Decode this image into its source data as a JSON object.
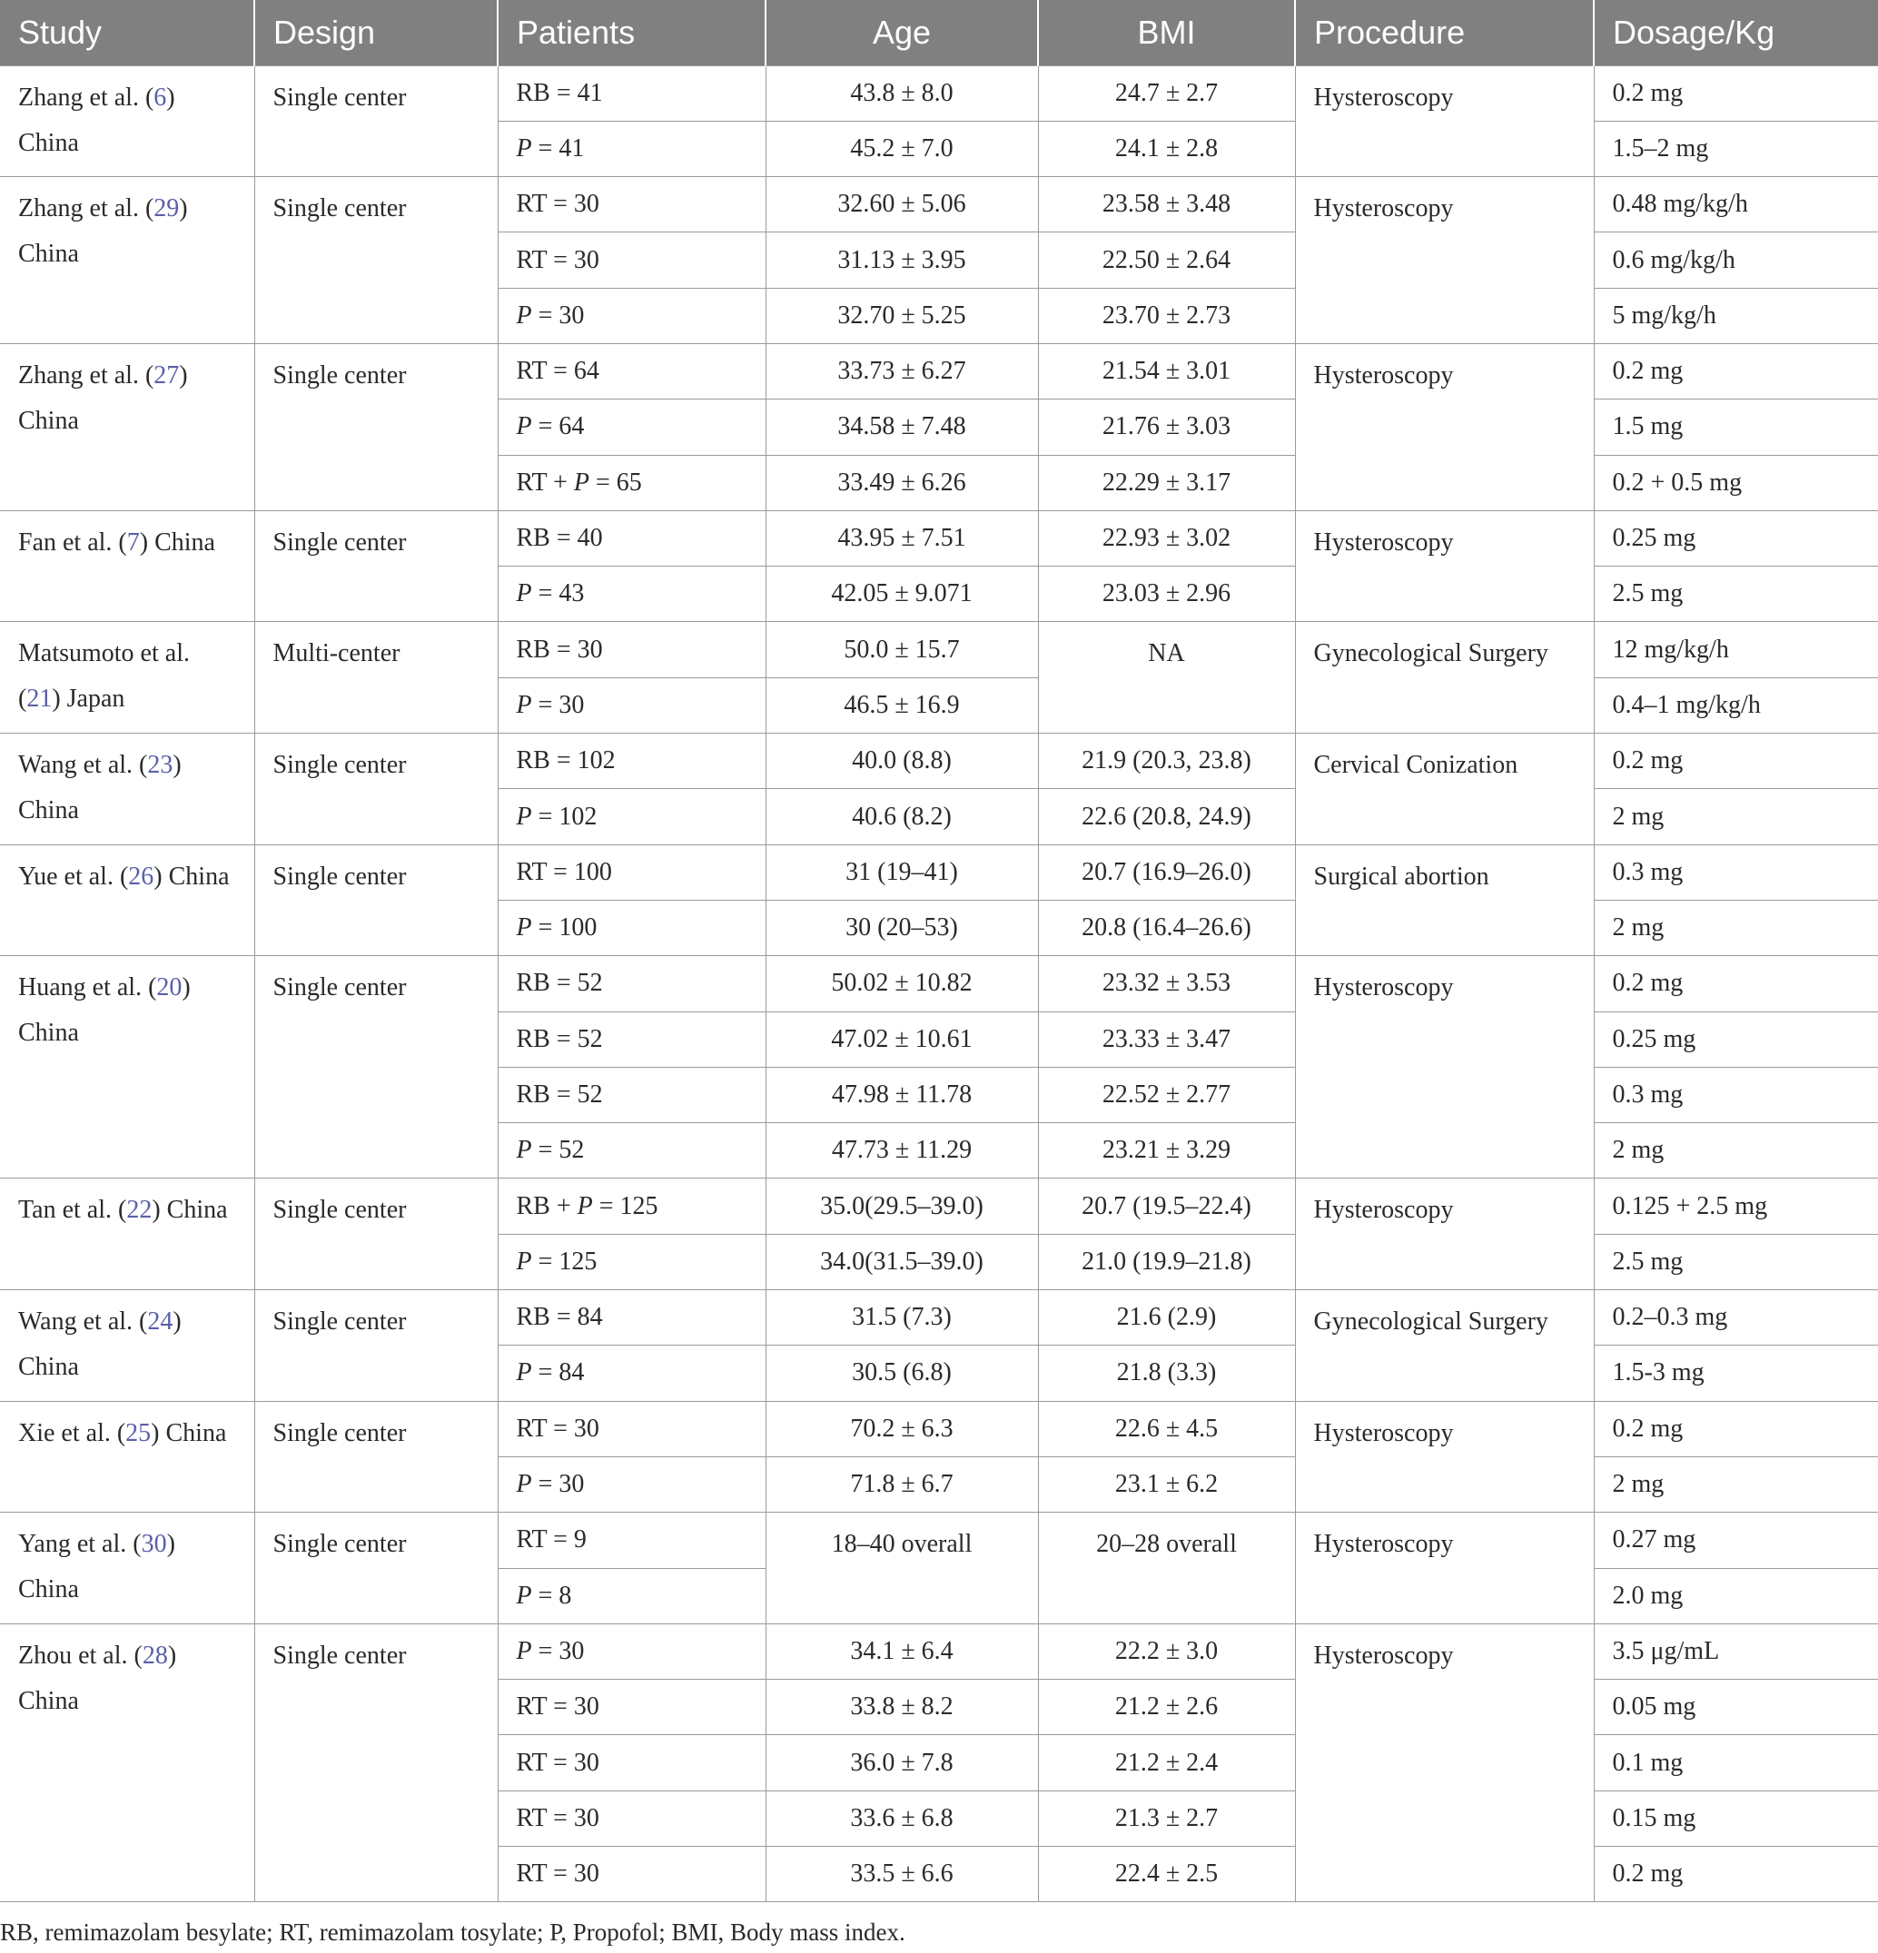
{
  "headers": [
    "Study",
    "Design",
    "Patients",
    "Age",
    "BMI",
    "Procedure",
    "Dosage/Kg"
  ],
  "studies": [
    {
      "author": "Zhang et al. (",
      "ref": "6",
      "after": ")",
      "country": "China",
      "design": "Single center",
      "procedure": "Hysteroscopy",
      "arms": [
        {
          "group": "RB = 41",
          "age": "43.8 ± 8.0",
          "bmi": "24.7 ± 2.7",
          "dosage": "0.2 mg"
        },
        {
          "group": "P = 41",
          "age": "45.2 ± 7.0",
          "bmi": "24.1 ± 2.8",
          "dosage": "1.5–2 mg"
        }
      ]
    },
    {
      "author": "Zhang et al. (",
      "ref": "29",
      "after": ")",
      "country": "China",
      "design": "Single center",
      "procedure": "Hysteroscopy",
      "arms": [
        {
          "group": "RT = 30",
          "age": "32.60 ± 5.06",
          "bmi": "23.58 ± 3.48",
          "dosage": "0.48 mg/kg/h"
        },
        {
          "group": "RT = 30",
          "age": "31.13 ± 3.95",
          "bmi": "22.50 ± 2.64",
          "dosage": "0.6 mg/kg/h"
        },
        {
          "group": "P = 30",
          "age": "32.70 ± 5.25",
          "bmi": "23.70 ± 2.73",
          "dosage": "5 mg/kg/h"
        }
      ]
    },
    {
      "author": "Zhang et al. (",
      "ref": "27",
      "after": ")",
      "country": "China",
      "design": "Single center",
      "procedure": "Hysteroscopy",
      "arms": [
        {
          "group": "RT = 64",
          "age": "33.73 ± 6.27",
          "bmi": "21.54 ± 3.01",
          "dosage": "0.2 mg"
        },
        {
          "group": "P = 64",
          "age": "34.58 ± 7.48",
          "bmi": "21.76 ± 3.03",
          "dosage": "1.5 mg"
        },
        {
          "group": "RT + P = 65",
          "age": "33.49 ± 6.26",
          "bmi": "22.29 ± 3.17",
          "dosage": "0.2 + 0.5 mg"
        }
      ]
    },
    {
      "author": "Fan et al. (",
      "ref": "7",
      "after": ") China",
      "country": "",
      "design": "Single center",
      "procedure": "Hysteroscopy",
      "arms": [
        {
          "group": "RB = 40",
          "age": "43.95 ± 7.51",
          "bmi": "22.93 ± 3.02",
          "dosage": "0.25 mg"
        },
        {
          "group": "P = 43",
          "age": "42.05 ± 9.071",
          "bmi": "23.03 ± 2.96",
          "dosage": "2.5 mg"
        }
      ]
    },
    {
      "author": "Matsumoto et al.",
      "ref": "21",
      "after": ") Japan",
      "country": "",
      "design": "Multi-center",
      "procedure": "Gynecological Surgery",
      "bmi_merged": "NA",
      "arms": [
        {
          "group": "RB = 30",
          "age": "50.0 ± 15.7",
          "bmi": "",
          "dosage": "12 mg/kg/h"
        },
        {
          "group": "P = 30",
          "age": "46.5 ± 16.9",
          "bmi": "",
          "dosage": "0.4–1 mg/kg/h"
        }
      ]
    },
    {
      "author": "Wang et al. (",
      "ref": "23",
      "after": ")",
      "country": "China",
      "design": "Single center",
      "procedure": "Cervical Conization",
      "arms": [
        {
          "group": "RB = 102",
          "age": "40.0 (8.8)",
          "bmi": "21.9 (20.3, 23.8)",
          "dosage": "0.2 mg"
        },
        {
          "group": "P = 102",
          "age": "40.6 (8.2)",
          "bmi": "22.6 (20.8, 24.9)",
          "dosage": "2 mg"
        }
      ]
    },
    {
      "author": "Yue et al. (",
      "ref": "26",
      "after": ") China",
      "country": "",
      "design": "Single center",
      "procedure": "Surgical abortion",
      "arms": [
        {
          "group": "RT = 100",
          "age": "31 (19–41)",
          "bmi": "20.7 (16.9–26.0)",
          "dosage": "0.3 mg"
        },
        {
          "group": "P = 100",
          "age": "30 (20–53)",
          "bmi": "20.8 (16.4–26.6)",
          "dosage": "2 mg"
        }
      ]
    },
    {
      "author": "Huang et al. (",
      "ref": "20",
      "after": ")",
      "country": "China",
      "design": "Single center",
      "procedure": "Hysteroscopy",
      "arms": [
        {
          "group": "RB = 52",
          "age": "50.02 ± 10.82",
          "bmi": "23.32 ± 3.53",
          "dosage": "0.2 mg"
        },
        {
          "group": "RB = 52",
          "age": "47.02 ± 10.61",
          "bmi": "23.33 ± 3.47",
          "dosage": "0.25 mg"
        },
        {
          "group": "RB = 52",
          "age": "47.98 ± 11.78",
          "bmi": "22.52 ± 2.77",
          "dosage": "0.3 mg"
        },
        {
          "group": "P = 52",
          "age": "47.73 ± 11.29",
          "bmi": "23.21 ± 3.29",
          "dosage": "2 mg"
        }
      ]
    },
    {
      "author": "Tan et al. (",
      "ref": "22",
      "after": ") China",
      "country": "",
      "design": "Single center",
      "procedure": "Hysteroscopy",
      "arms": [
        {
          "group": "RB + P = 125",
          "age": "35.0(29.5–39.0)",
          "bmi": "20.7 (19.5–22.4)",
          "dosage": "0.125 + 2.5 mg"
        },
        {
          "group": "P = 125",
          "age": "34.0(31.5–39.0)",
          "bmi": "21.0 (19.9–21.8)",
          "dosage": "2.5 mg"
        }
      ]
    },
    {
      "author": "Wang et al. (",
      "ref": "24",
      "after": ")",
      "country": "China",
      "design": "Single center",
      "procedure": "Gynecological Surgery",
      "arms": [
        {
          "group": "RB = 84",
          "age": "31.5 (7.3)",
          "bmi": "21.6 (2.9)",
          "dosage": "0.2–0.3 mg"
        },
        {
          "group": "P = 84",
          "age": "30.5 (6.8)",
          "bmi": "21.8 (3.3)",
          "dosage": "1.5-3 mg"
        }
      ]
    },
    {
      "author": "Xie et al. (",
      "ref": "25",
      "after": ") China",
      "country": "",
      "design": "Single center",
      "procedure": "Hysteroscopy",
      "arms": [
        {
          "group": "RT = 30",
          "age": "70.2 ± 6.3",
          "bmi": "22.6 ± 4.5",
          "dosage": "0.2 mg"
        },
        {
          "group": "P = 30",
          "age": "71.8 ± 6.7",
          "bmi": "23.1 ± 6.2",
          "dosage": "2 mg"
        }
      ]
    },
    {
      "author": "Yang et al. (",
      "ref": "30",
      "after": ")",
      "country": "China",
      "design": "Single center",
      "procedure": "Hysteroscopy",
      "age_merged": "18–40 overall",
      "bmi_merged": "20–28 overall",
      "arms": [
        {
          "group": "RT = 9",
          "age": "",
          "bmi": "",
          "dosage": "0.27 mg"
        },
        {
          "group": "P = 8",
          "age": "",
          "bmi": "",
          "dosage": "2.0 mg"
        }
      ]
    },
    {
      "author": "Zhou et al. (",
      "ref": "28",
      "after": ")",
      "country": "China",
      "design": "Single center",
      "procedure": "Hysteroscopy",
      "arms": [
        {
          "group": "P = 30",
          "age": "34.1 ± 6.4",
          "bmi": "22.2 ± 3.0",
          "dosage": "3.5 μg/mL"
        },
        {
          "group": "RT = 30",
          "age": "33.8 ± 8.2",
          "bmi": "21.2 ± 2.6",
          "dosage": "0.05 mg"
        },
        {
          "group": "RT = 30",
          "age": "36.0 ± 7.8",
          "bmi": "21.2 ± 2.4",
          "dosage": "0.1 mg"
        },
        {
          "group": "RT = 30",
          "age": "33.6 ± 6.8",
          "bmi": "21.3 ± 2.7",
          "dosage": "0.15 mg"
        },
        {
          "group": "RT = 30",
          "age": "33.5 ± 6.6",
          "bmi": "22.4 ± 2.5",
          "dosage": "0.2 mg"
        }
      ]
    }
  ],
  "footnote": "RB, remimazolam besylate; RT, remimazolam tosylate; P, Propofol; BMI, Body mass index."
}
